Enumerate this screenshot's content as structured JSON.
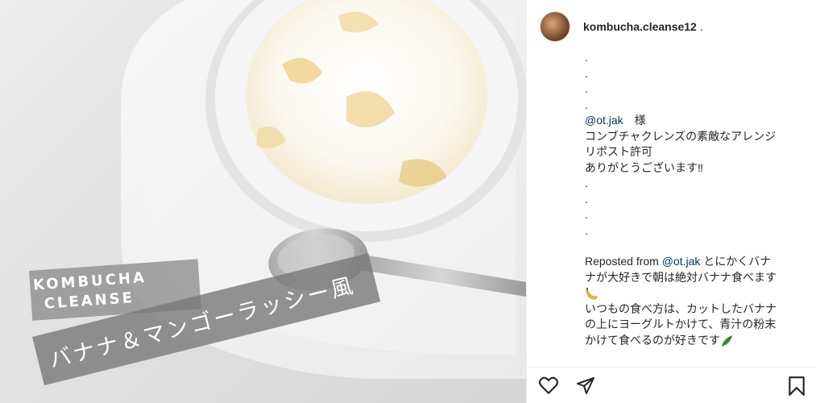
{
  "photo": {
    "brand_line1": "KOMBUCHA",
    "brand_line2": "CLEANSE",
    "banner_text": "バナナ＆マンゴーラッシー風"
  },
  "header": {
    "username": "kombucha.cleanse12",
    "username_suffix": ".",
    "avatar_icon": "avatar"
  },
  "caption": {
    "dots_top": [
      ".",
      ".",
      ".",
      "."
    ],
    "mention1": "@ot.jak",
    "honorific": "　様",
    "line2": "コンブチャクレンズの素敵なアレンジ",
    "line3": "リポスト許可",
    "line4": "ありがとうございます‼",
    "dots_mid": [
      ".",
      ".",
      ".",
      "."
    ],
    "repost_prefix": "Reposted from ",
    "repost_mention": "@ot.jak",
    "repost_line1_rest": " とにかくバナ",
    "repost_line2": "ナが大好きで朝は絶対バナナ食べます",
    "repost_line3": "いつもの食べ方は、カットしたバナナ",
    "repost_line4": "の上にヨーグルトかけて、青汁の粉末",
    "repost_line5": "かけて食べるのが好きです"
  },
  "actions": {
    "like_icon": "heart-icon",
    "share_icon": "send-icon",
    "save_icon": "bookmark-icon"
  },
  "colors": {
    "text": "#262626",
    "mention": "#00376b",
    "banner": "#7a7a7a"
  }
}
